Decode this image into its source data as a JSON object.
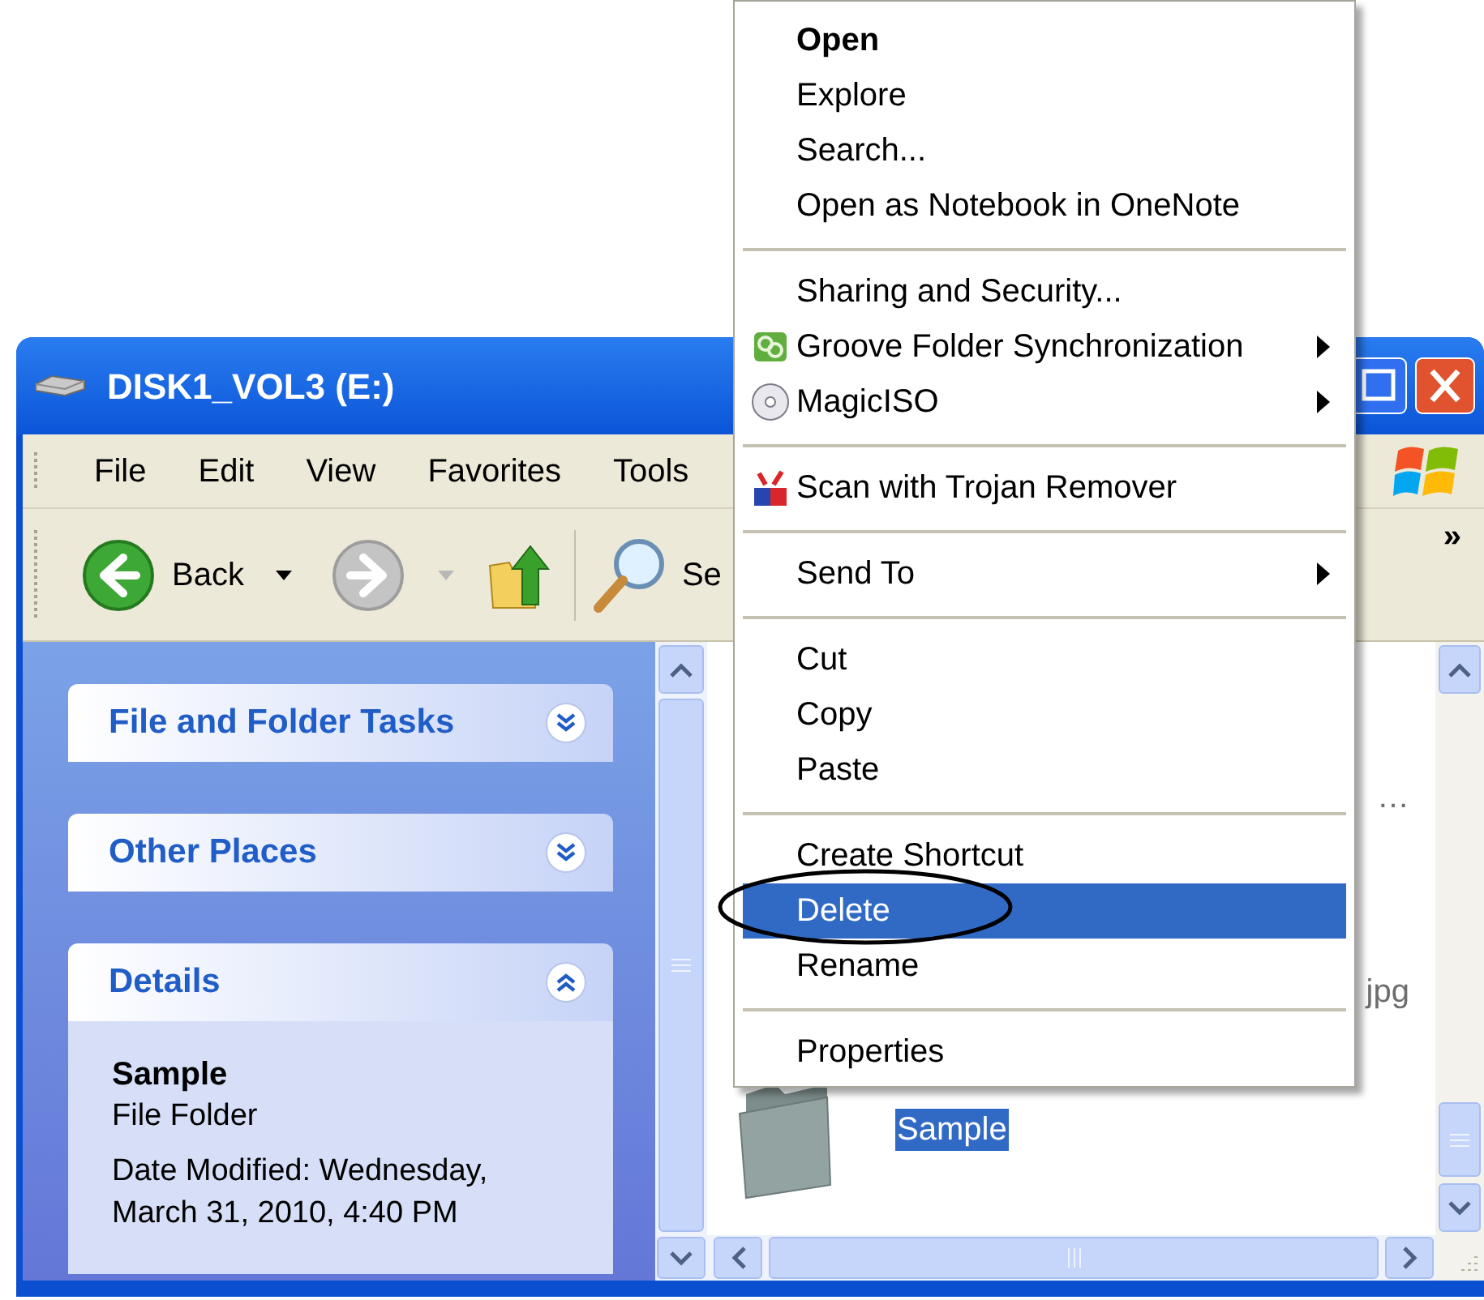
{
  "window": {
    "title": "DISK1_VOL3 (E:)"
  },
  "menu_bar": [
    "File",
    "Edit",
    "View",
    "Favorites",
    "Tools"
  ],
  "toolbar": {
    "back": "Back",
    "search": "Se",
    "overflow": "»"
  },
  "task_pane": {
    "panels": [
      {
        "title": "File and Folder Tasks",
        "expanded": false
      },
      {
        "title": "Other Places",
        "expanded": false
      },
      {
        "title": "Details",
        "expanded": true,
        "name": "Sample",
        "type": "File Folder",
        "date_modified": "Date Modified: Wednesday, March 31, 2010, 4:40 PM"
      }
    ]
  },
  "files": [
    {
      "kind": "fragment",
      "label": "…",
      "selected": false
    },
    {
      "kind": "fragment",
      "label": "jpg",
      "selected": false
    },
    {
      "kind": "folder",
      "label": "Sample",
      "selected": true
    }
  ],
  "context_menu": [
    {
      "kind": "item",
      "label": "Open",
      "default": true,
      "submenu": false,
      "selected": false
    },
    {
      "kind": "item",
      "label": "Explore",
      "default": false,
      "submenu": false,
      "selected": false
    },
    {
      "kind": "item",
      "label": "Search...",
      "default": false,
      "submenu": false,
      "selected": false
    },
    {
      "kind": "item",
      "label": "Open as Notebook in OneNote",
      "default": false,
      "submenu": false,
      "selected": false
    },
    {
      "kind": "separator"
    },
    {
      "kind": "item",
      "label": "Sharing and Security...",
      "default": false,
      "submenu": false,
      "selected": false
    },
    {
      "kind": "item",
      "label": "Groove Folder Synchronization",
      "default": false,
      "submenu": true,
      "selected": false
    },
    {
      "kind": "item",
      "label": "MagicISO",
      "default": false,
      "submenu": true,
      "selected": false
    },
    {
      "kind": "separator"
    },
    {
      "kind": "item",
      "label": "Scan with Trojan Remover",
      "default": false,
      "submenu": false,
      "selected": false
    },
    {
      "kind": "separator"
    },
    {
      "kind": "item",
      "label": "Send To",
      "default": false,
      "submenu": true,
      "selected": false
    },
    {
      "kind": "separator"
    },
    {
      "kind": "item",
      "label": "Cut",
      "default": false,
      "submenu": false,
      "selected": false
    },
    {
      "kind": "item",
      "label": "Copy",
      "default": false,
      "submenu": false,
      "selected": false
    },
    {
      "kind": "item",
      "label": "Paste",
      "default": false,
      "submenu": false,
      "selected": false
    },
    {
      "kind": "separator"
    },
    {
      "kind": "item",
      "label": "Create Shortcut",
      "default": false,
      "submenu": false,
      "selected": false
    },
    {
      "kind": "item",
      "label": "Delete",
      "default": false,
      "submenu": false,
      "selected": true
    },
    {
      "kind": "item",
      "label": "Rename",
      "default": false,
      "submenu": false,
      "selected": false
    },
    {
      "kind": "separator"
    },
    {
      "kind": "item",
      "label": "Properties",
      "default": false,
      "submenu": false,
      "selected": false
    }
  ]
}
